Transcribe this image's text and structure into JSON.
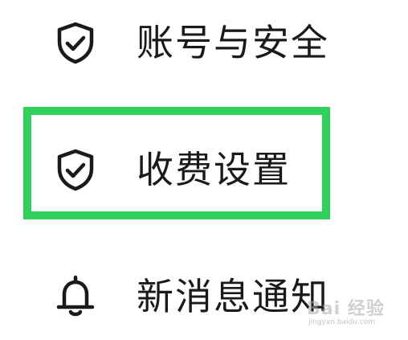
{
  "menu": {
    "items": [
      {
        "label": "账号与安全",
        "icon": "shield-check-icon"
      },
      {
        "label": "收费设置",
        "icon": "shield-check-icon",
        "highlighted": true
      },
      {
        "label": "新消息通知",
        "icon": "bell-icon"
      }
    ]
  },
  "colors": {
    "highlight": "#2fd15a",
    "text": "#1a1a1a",
    "icon": "#1a1a1a"
  },
  "watermark": {
    "main": "Bai 经验",
    "sub": "jingyan.baidu.com"
  }
}
